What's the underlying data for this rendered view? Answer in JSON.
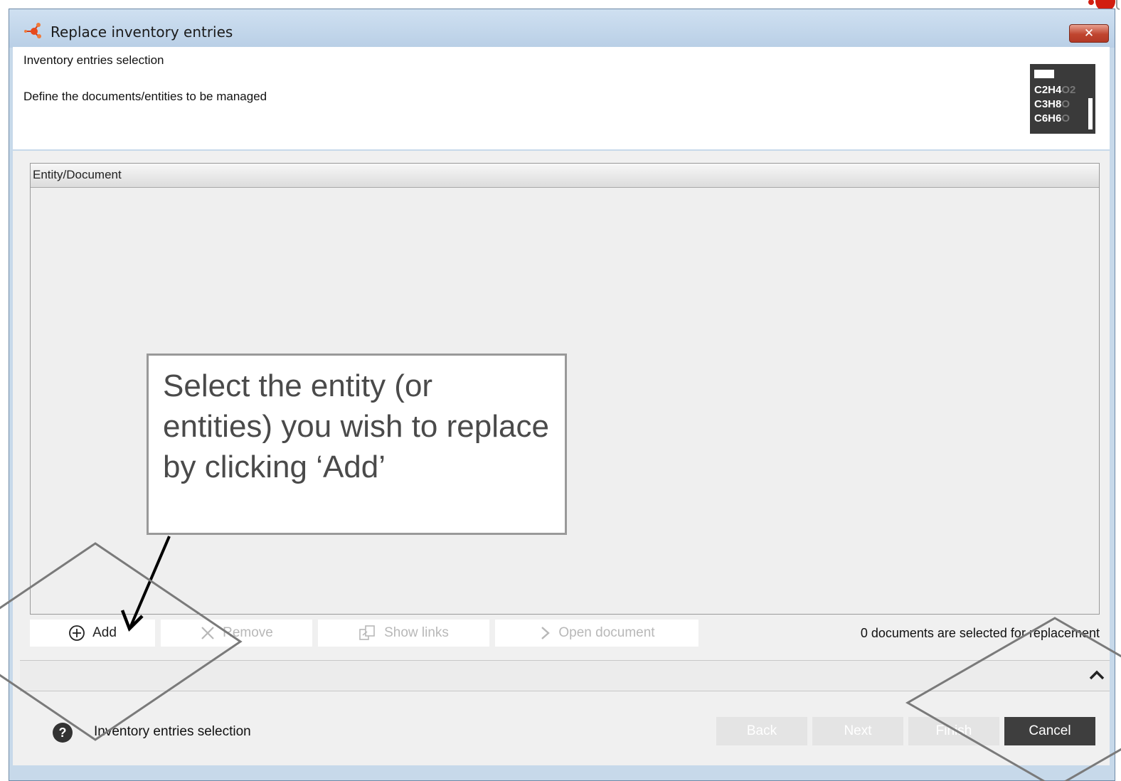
{
  "window": {
    "title": "Replace inventory entries",
    "close_label": "✕"
  },
  "header": {
    "title": "Inventory entries selection",
    "description": "Define the documents/entities to be managed",
    "logo": {
      "line1_main": "C2H4",
      "line1_faded": "O2",
      "line2_main": "C3H8",
      "line2_faded": "O",
      "line3_main": "C6H6",
      "line3_faded": "O"
    }
  },
  "table": {
    "column_header": "Entity/Document",
    "rows": []
  },
  "toolbar": {
    "add_label": "Add",
    "remove_label": "Remove",
    "show_links_label": "Show links",
    "open_document_label": "Open document",
    "selection_count_text": "0 documents are selected for replacement"
  },
  "footer": {
    "step_label": "Inventory entries selection",
    "back_label": "Back",
    "next_label": "Next",
    "finish_label": "Finish",
    "cancel_label": "Cancel"
  },
  "callout": {
    "text": "Select the entity (or entities) you wish to replace by clicking ‘Add’"
  },
  "colors": {
    "title_bar": "#c7d9ea",
    "close_button": "#c0452f",
    "cancel_button": "#3e3e3e",
    "disabled_button": "#e4e4e4",
    "annotation_gray": "#808080"
  }
}
